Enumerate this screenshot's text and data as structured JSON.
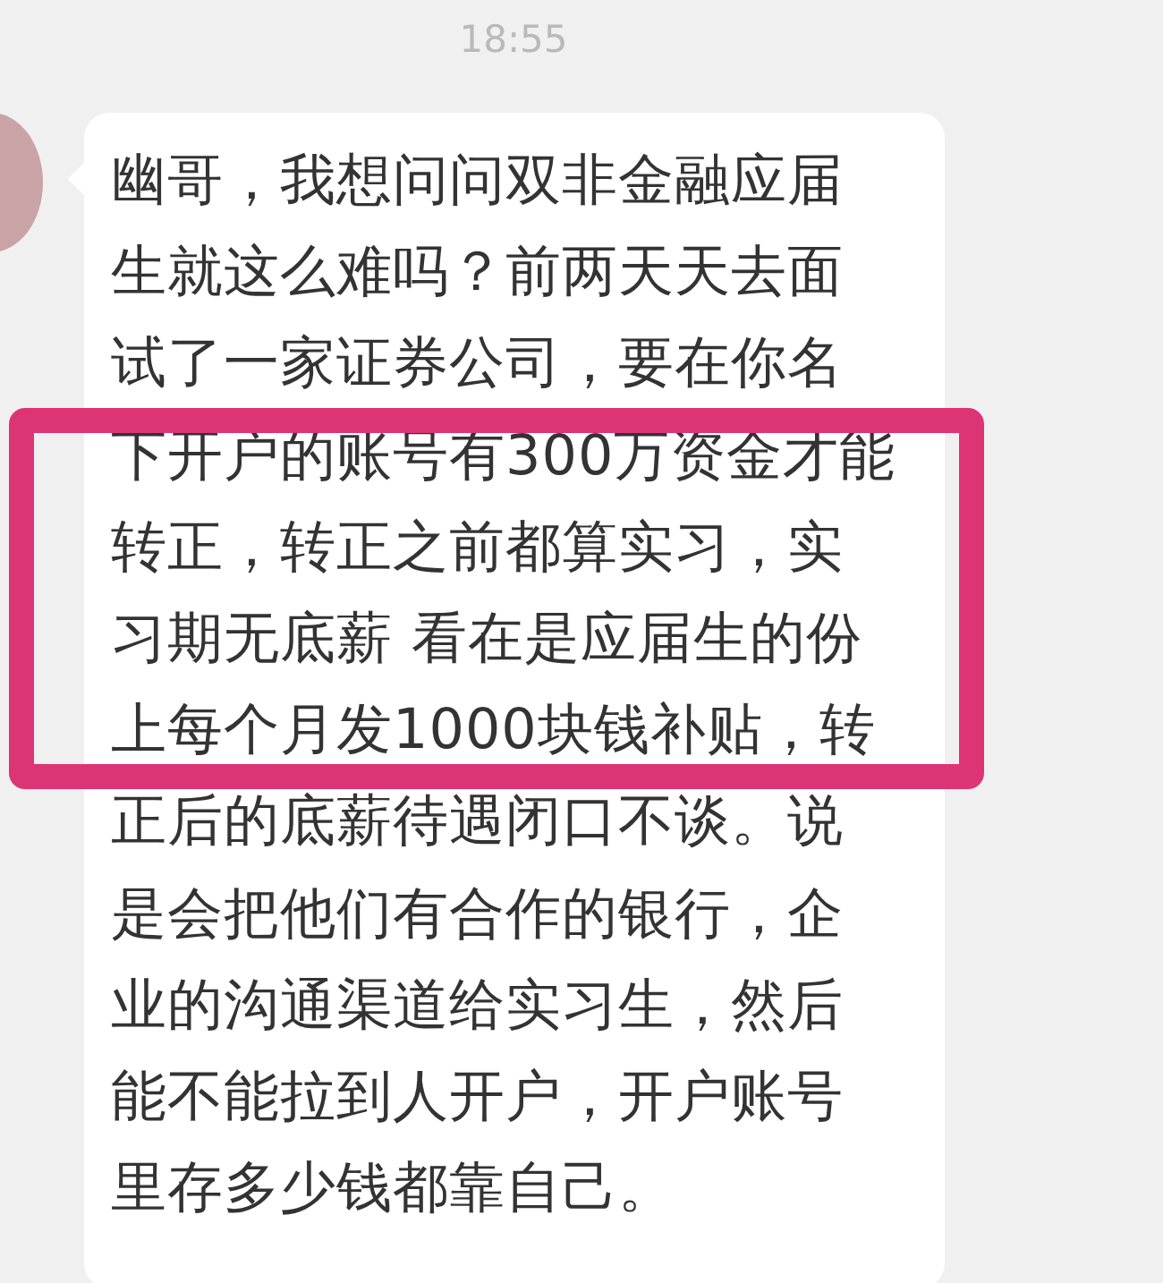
{
  "timestamp": "18:55",
  "message": {
    "lines": [
      "幽哥，我想问问双非金融应届",
      "生就这么难吗？前两天天去面",
      "试了一家证券公司，要在你名",
      "下开户的账号有300万资金才能",
      "转正，转正之前都算实习，实",
      "习期无底薪 看在是应届生的份",
      "上每个月发1000块钱补贴，转",
      "正后的底薪待遇闭口不谈。说",
      "是会把他们有合作的银行，企",
      "业的沟通渠道给实习生，然后",
      "能不能拉到人开户，开户账号",
      "里存多少钱都靠自己。"
    ]
  },
  "highlight_frame": true
}
